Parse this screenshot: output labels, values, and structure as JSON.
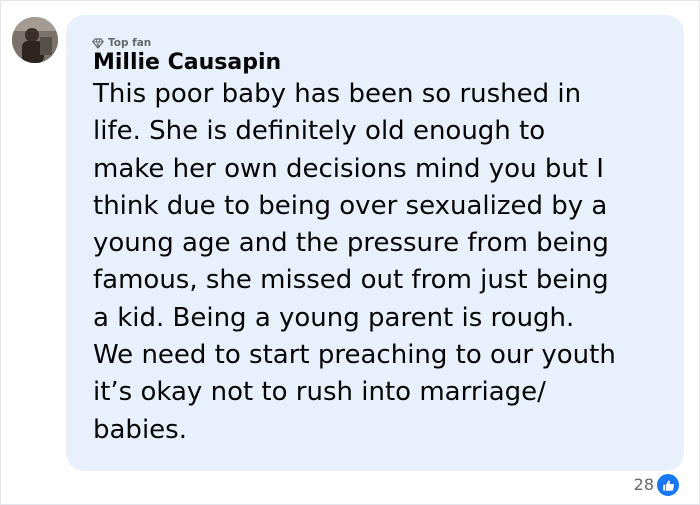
{
  "comment": {
    "badge": "Top fan",
    "badge_icon": "diamond-icon",
    "author": "Millie Causapin",
    "text": "This poor baby has been so rushed in\nlife. She is definitely old enough to\nmake her own decisions mind you but I\nthink due to being over sexualized by a\nyoung age and the pressure from being\nfamous, she missed out from just being\na kid. Being a young parent is rough.\nWe need to start preaching to our youth\nit’s okay not to rush into marriage/\nbabies.",
    "reaction_count": "28",
    "reaction_icon": "like-icon",
    "colors": {
      "bubble": "#e8f1fb",
      "text": "#050505",
      "meta": "#65676b",
      "like": "#1877f2"
    }
  }
}
